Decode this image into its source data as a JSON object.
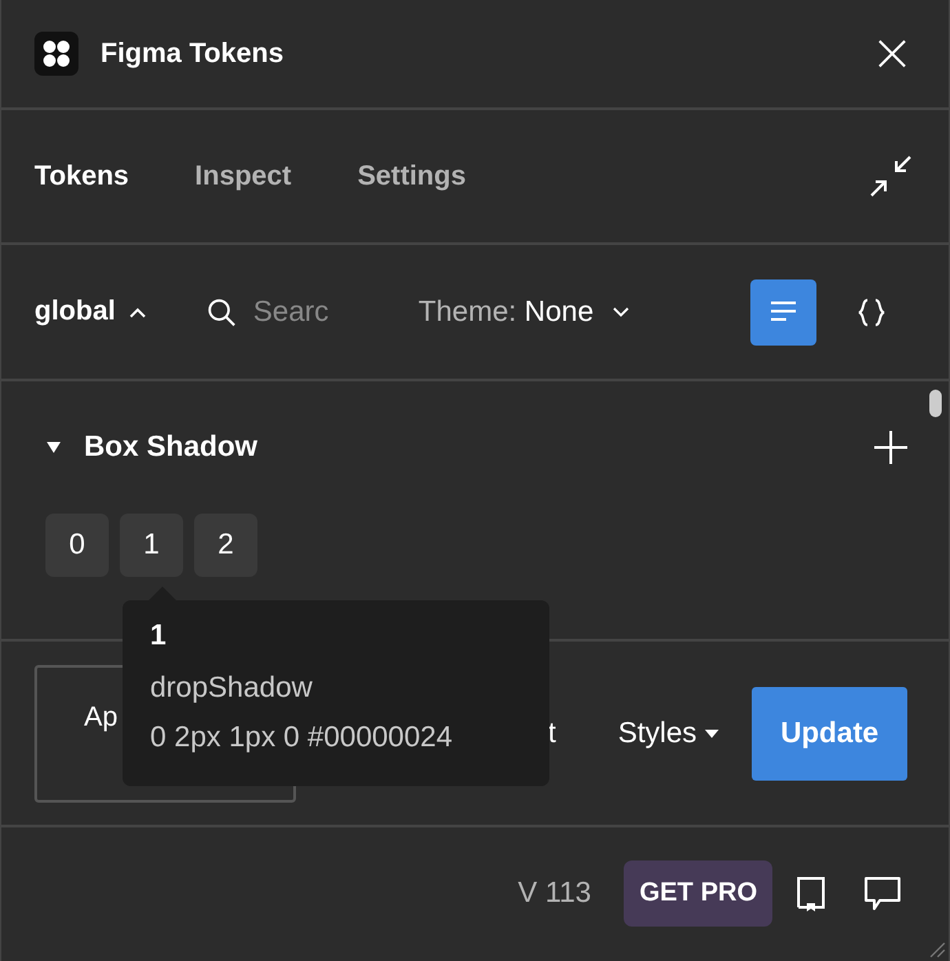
{
  "window": {
    "title": "Figma Tokens"
  },
  "tabs": [
    {
      "label": "Tokens",
      "selected": true
    },
    {
      "label": "Inspect",
      "selected": false
    },
    {
      "label": "Settings",
      "selected": false
    }
  ],
  "toolbar": {
    "token_set": "global",
    "search": {
      "placeholder": "Searc"
    },
    "theme_label": "Theme:",
    "theme_value": "None",
    "view_modes": [
      {
        "kind": "list",
        "selected": true
      },
      {
        "kind": "json",
        "selected": false
      }
    ]
  },
  "section": {
    "title": "Box Shadow",
    "expanded": true,
    "tokens": [
      {
        "label": "0"
      },
      {
        "label": "1"
      },
      {
        "label": "2"
      }
    ]
  },
  "tooltip": {
    "name": "1",
    "type": "dropShadow",
    "value": "0 2px 1px 0 #00000024"
  },
  "actions": {
    "apply_label": "Ap",
    "hidden_text": "t",
    "styles_label": "Styles",
    "update_label": "Update"
  },
  "footer": {
    "version": "V 113",
    "pro_label": "GET PRO"
  }
}
